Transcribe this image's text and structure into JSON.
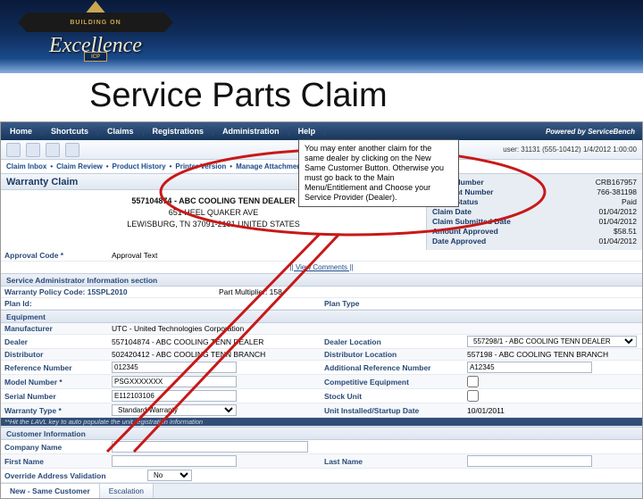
{
  "slide_title": "Service Parts Claim",
  "medallion": {
    "top_text": "BUILDING ON",
    "script": "Excellence",
    "icp": "ICP"
  },
  "nav": {
    "items": [
      "Home",
      "Shortcuts",
      "Claims",
      "Registrations",
      "Administration",
      "Help"
    ],
    "powered": "Powered by",
    "brand": "ServiceBench"
  },
  "toolbar": {
    "user": "user: 31131 (555-10412)  1/4/2012 1:00:00"
  },
  "crumbs": [
    "Claim Inbox",
    "Claim Review",
    "Product History",
    "Printer Version",
    "Manage Attachments"
  ],
  "page_header": "Warranty Claim",
  "dealer": {
    "line1": "557104874 - ABC COOLING TENN DEALER",
    "line2": "651 HEEL QUAKER AVE",
    "line3": "LEWISBURG, TN 37091-2181 UNITED STATES"
  },
  "summary": {
    "claim_number_lab": "Claim Number",
    "claim_number": "CRB167957",
    "account_number_lab": "Account Number",
    "account_number": "766-381198",
    "claim_status_lab": "Claim Status",
    "claim_status": "Paid",
    "claim_date_lab": "Claim Date",
    "claim_date": "01/04/2012",
    "submitted_lab": "Claim Submitted Date",
    "submitted": "01/04/2012",
    "amount_lab": "Amount Approved",
    "amount": "$58.51",
    "date_approved_lab": "Date Approved",
    "date_approved": "01/04/2012"
  },
  "approval": {
    "code_lab": "Approval Code *",
    "text_lab": "Approval Text",
    "view_comments": "|| View Comments ||"
  },
  "sect_admin": "Service Administrator Information section",
  "admin": {
    "policy_lab": "Warranty Policy Code: 15SPL2010",
    "mult_lab": "Part Multiplier: 158",
    "plan_lab": "Plan Id:",
    "plan_type_lab": "Plan Type"
  },
  "sect_equip": "Equipment",
  "equip": {
    "mfr_lab": "Manufacturer",
    "mfr": "UTC - United Technologies Corporation",
    "dealer_lab": "Dealer",
    "dealer": "557104874 - ABC COOLING TENN DEALER",
    "dealer_loc_lab": "Dealer Location",
    "dealer_loc": "557298/1 - ABC COOLING TENN DEALER",
    "dist_lab": "Distributor",
    "dist": "502420412 - ABC COOLING TENN BRANCH",
    "dist_loc_lab": "Distributor Location",
    "dist_loc": "557198 - ABC COOLING TENN BRANCH",
    "ref_lab": "Reference Number",
    "ref": "012345",
    "add_ref_lab": "Additional Reference Number",
    "add_ref": "A12345",
    "model_lab": "Model Number *",
    "model": "PSGXXXXXXX",
    "comp_lab": "Competitive Equipment",
    "serial_lab": "Serial Number",
    "serial": "E112103106",
    "stock_lab": "Stock Unit",
    "wtype_lab": "Warranty Type *",
    "wtype": "Standard Warranty",
    "install_lab": "Unit Installed/Startup Date",
    "install": "10/01/2011",
    "hint": "**Hit the LAVL key to auto populate the unit registration information"
  },
  "sect_cust": "Customer Information",
  "cust": {
    "company_lab": "Company Name",
    "first_lab": "First Name",
    "last_lab": "Last Name",
    "override_lab": "Override Address Validation",
    "override": "No"
  },
  "tabs": {
    "new_same": "New - Same Customer",
    "escalation": "Escalation"
  },
  "callout": "You may enter another claim for the same dealer by clicking on the New Same Customer Button. Otherwise you must go back to the Main Menu/Entitlement and Choose your Service Provider (Dealer)."
}
